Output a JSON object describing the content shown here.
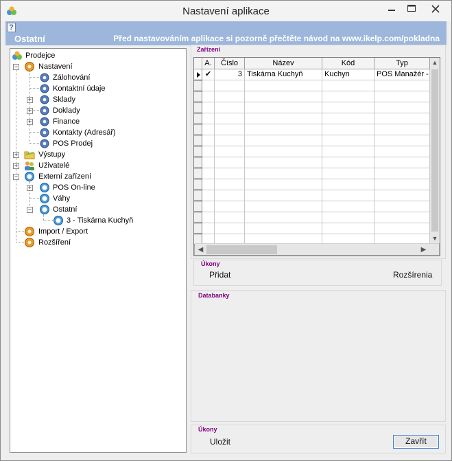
{
  "window": {
    "title": "Nastavení aplikace",
    "controls": {
      "minimize": "minimize-icon",
      "maximize": "maximize-icon",
      "close": "close-icon"
    }
  },
  "header": {
    "help": "?",
    "section": "Ostatní",
    "notice": "Před nastavováním aplikace si pozorně přečtěte návod na www.ikelp.com/pokladna"
  },
  "tree": {
    "root": "Prodejce",
    "nastaveni": "Nastavení",
    "zalohovani": "Zálohování",
    "kontaktni": "Kontaktní údaje",
    "sklady": "Sklady",
    "doklady": "Doklady",
    "finance": "Finance",
    "kontakty": "Kontakty (Adresář)",
    "posprodej": "POS Prodej",
    "vystupy": "Výstupy",
    "uzivatele": "Uživatelé",
    "externi": "Externí zařízení",
    "posonline": "POS On-line",
    "vahy": "Váhy",
    "ostatni": "Ostatní",
    "tiskarna": "3 - Tiskárna Kuchyň",
    "import": "Import / Export",
    "rozsireni": "Rozšíření",
    "expander_plus": "+",
    "expander_minus": "−"
  },
  "zarizeni": {
    "group_title": "Zařízení",
    "columns": [
      "A.",
      "Číslo",
      "Název",
      "Kód",
      "Typ"
    ],
    "rows": [
      {
        "a": "✔",
        "cislo": "3",
        "nazev": "Tiskárna Kuchyň",
        "kod": "Kuchyn",
        "typ": "POS Manažér - l"
      }
    ]
  },
  "ukony_top": {
    "group_title": "Úkony",
    "pridat": "Přidat",
    "rozsirenia": "Rozšírenia"
  },
  "databanky": {
    "group_title": "Databanky"
  },
  "ukony_bottom": {
    "group_title": "Úkony",
    "ulozit": "Uložit",
    "zavrit": "Zavřít"
  }
}
